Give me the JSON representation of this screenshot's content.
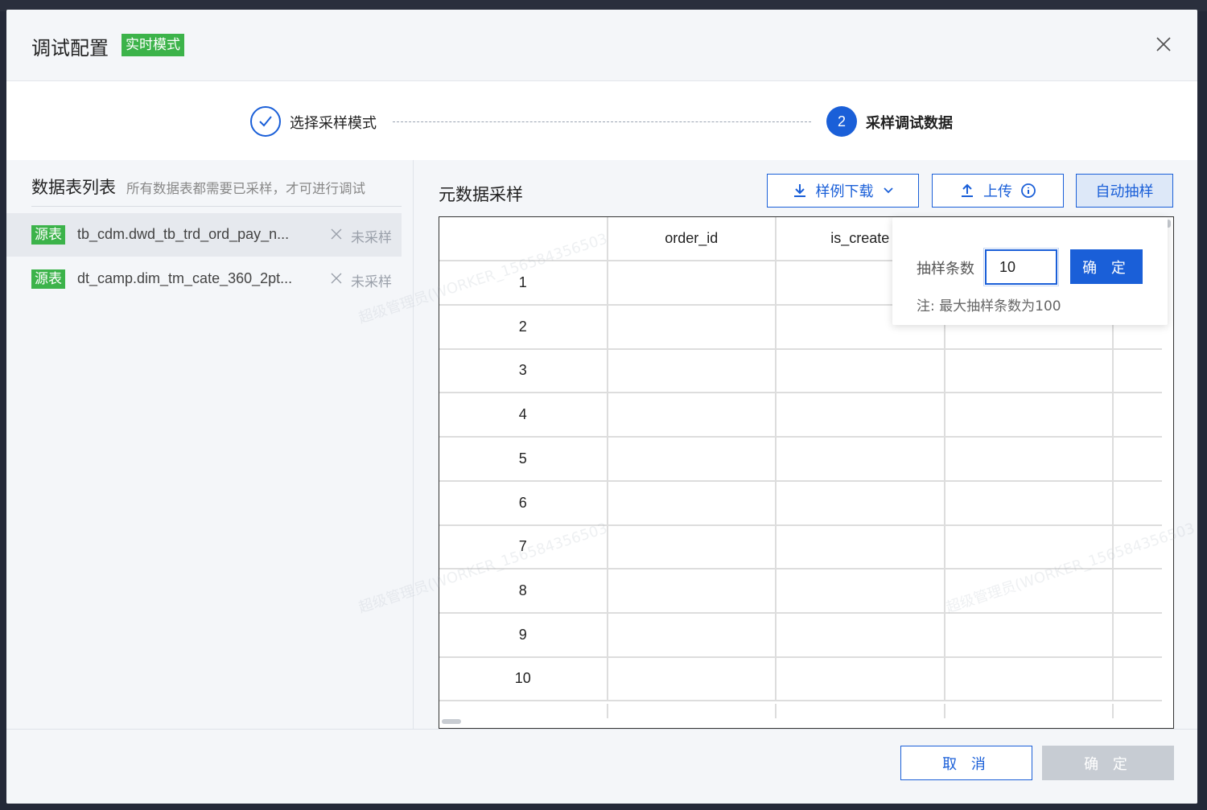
{
  "dialog": {
    "title": "调试配置",
    "mode_badge": "实时模式"
  },
  "steps": [
    {
      "label": "选择采样模式",
      "state": "done"
    },
    {
      "label": "采样调试数据",
      "number": "2",
      "state": "active"
    }
  ],
  "left_panel": {
    "title": "数据表列表",
    "hint": "所有数据表都需要已采样，才可进行调试",
    "tables": [
      {
        "tag": "源表",
        "name": "tb_cdm.dwd_tb_trd_ord_pay_n...",
        "status": "未采样",
        "active": true
      },
      {
        "tag": "源表",
        "name": "dt_camp.dim_tm_cate_360_2pt...",
        "status": "未采样",
        "active": false
      }
    ]
  },
  "right_panel": {
    "title": "元数据采样",
    "download_button": "样例下载",
    "upload_button": "上传",
    "auto_sample_button": "自动抽样",
    "columns": [
      "",
      "order_id",
      "is_create",
      "",
      ""
    ],
    "rows": [
      "1",
      "2",
      "3",
      "4",
      "5",
      "6",
      "7",
      "8",
      "9",
      "10"
    ]
  },
  "popover": {
    "label": "抽样条数",
    "value": "10",
    "confirm": "确 定",
    "note": "注: 最大抽样条数为100"
  },
  "footer": {
    "cancel": "取 消",
    "ok": "确 定"
  },
  "watermark_text": "超级管理员(WORKER_156584356503",
  "colors": {
    "primary": "#1a5fd8",
    "badge_green": "#3cb34a",
    "disabled": "#c7ccd3"
  }
}
